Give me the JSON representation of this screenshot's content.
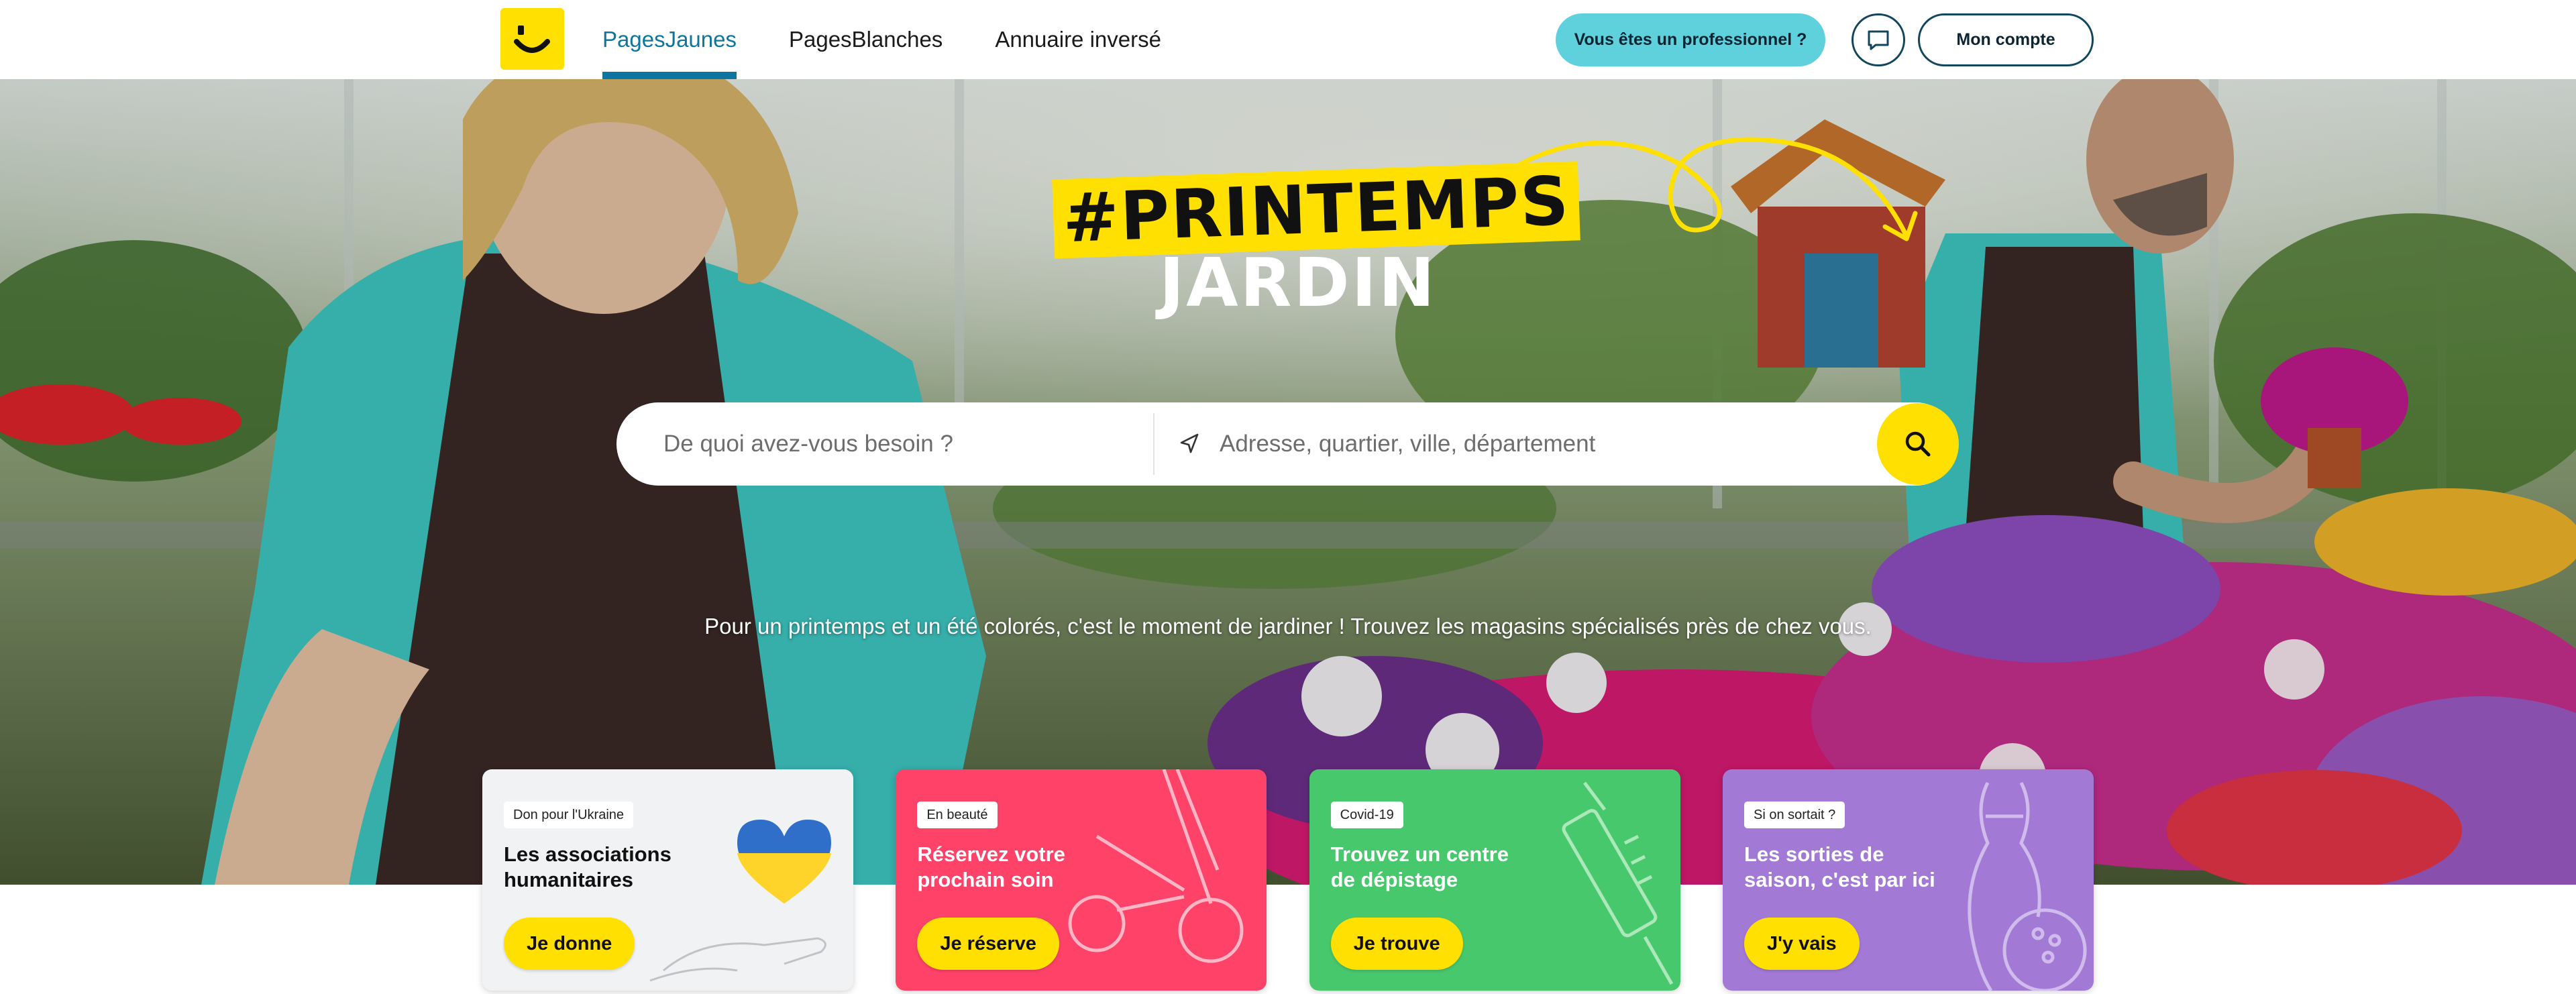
{
  "header": {
    "nav": [
      {
        "label": "PagesJaunes",
        "active": true
      },
      {
        "label": "PagesBlanches",
        "active": false
      },
      {
        "label": "Annuaire inversé",
        "active": false
      }
    ],
    "pro_button": "Vous êtes un professionnel ?",
    "account_button": "Mon compte",
    "icons": {
      "logo": "pagesjaunes-smile-logo",
      "messages": "chat-bubble-icon"
    }
  },
  "hero": {
    "headline_tag": "#PRINTEMPS",
    "headline_main": "JARDIN",
    "search": {
      "what_placeholder": "De quoi avez-vous besoin ?",
      "where_placeholder": "Adresse, quartier, ville, département",
      "location_icon": "location-arrow-icon",
      "submit_icon": "search-icon"
    },
    "tagline": "Pour un printemps et un été colorés, c'est le moment de jardiner ! Trouvez les magasins spécialisés près de chez vous."
  },
  "cards": [
    {
      "badge": "Don pour l'Ukraine",
      "title": "Les associations humanitaires",
      "cta": "Je donne",
      "color": "#f1f2f4"
    },
    {
      "badge": "En beauté",
      "title": "Réservez votre prochain soin",
      "cta": "Je réserve",
      "color": "#ff4268"
    },
    {
      "badge": "Covid-19",
      "title": "Trouvez un centre de dépistage",
      "cta": "Je trouve",
      "color": "#48c86d"
    },
    {
      "badge": "Si on sortait ?",
      "title": "Les sorties de saison, c'est par ici",
      "cta": "J'y vais",
      "color": "#a27ad6"
    }
  ],
  "colors": {
    "brand_yellow": "#ffe000",
    "brand_blue": "#0c76a0",
    "pro_cyan": "#5ed1dd"
  }
}
